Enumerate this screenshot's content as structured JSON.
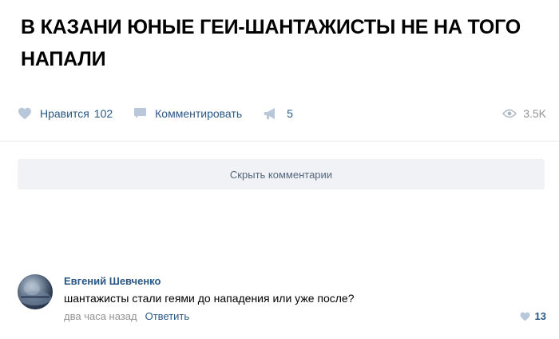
{
  "post": {
    "headline": "В КАЗАНИ ЮНЫЕ ГЕИ-ШАНТАЖИСТЫ НЕ НА ТОГО НАПАЛИ"
  },
  "actions": {
    "like_label": "Нравится",
    "like_count": "102",
    "comment_label": "Комментировать",
    "share_count": "5",
    "views_count": "3.5K"
  },
  "comments_toggle": {
    "label": "Скрыть комментарии"
  },
  "comment": {
    "author": "Евгений Шевченко",
    "text": "шантажисты стали геями до нападения или уже после?",
    "time": "два часа назад",
    "reply_label": "Ответить",
    "like_count": "13"
  },
  "colors": {
    "link": "#2a5885",
    "muted": "#939393",
    "icon": "#b8c7d9",
    "button_bg": "#f0f2f5"
  },
  "icons": [
    "heart-icon",
    "comment-icon",
    "share-icon",
    "eye-icon",
    "avatar"
  ]
}
